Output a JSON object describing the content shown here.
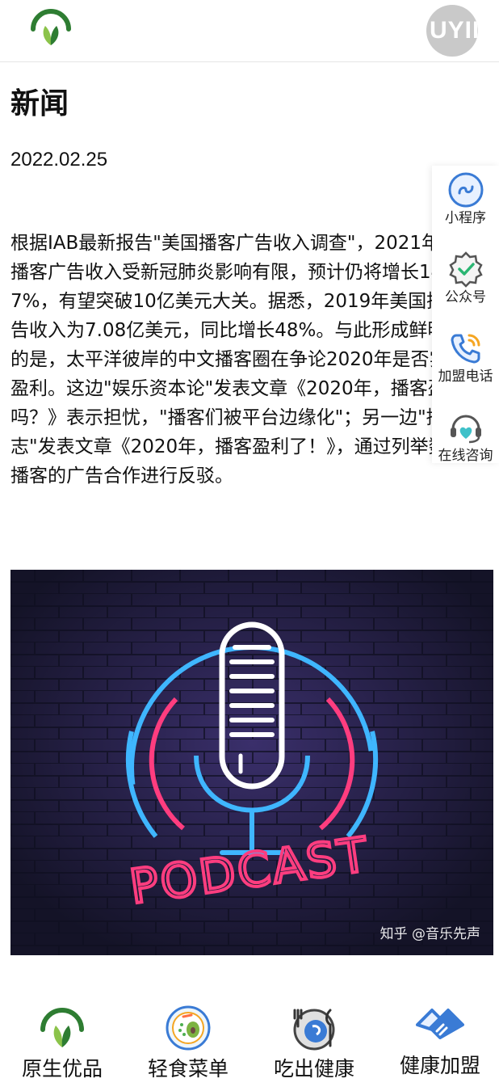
{
  "header": {
    "logo_icon": "leaf-logo-icon",
    "avatar_text": "UYII"
  },
  "page": {
    "title": "新闻",
    "date": "2022.02.25"
  },
  "article": {
    "paragraph": "根据IAB最新报告\"美国播客广告收入调查\"，2021年美国播客广告收入受新冠肺炎影响有限，预计仍将增长14.7%，有望突破10亿美元大关。据悉，2019年美国播客广告收入为7.08亿美元，同比增长48%。与此形成鲜明对比的是，太平洋彼岸的中文播客圈在争论2020年是否实现了盈利。这边\"娱乐资本论\"发表文章《2020年，播客盈利了吗？》表示担忧，\"播客们被平台边缘化\"；另一边\"播客志\"发表文章《2020年，播客盈利了！》，通过列举数十个播客的广告合作进行反驳。"
  },
  "side_panel": {
    "items": [
      {
        "label": "小程序",
        "icon": "mini-program-icon"
      },
      {
        "label": "公众号",
        "icon": "official-account-icon"
      },
      {
        "label": "加盟电话",
        "icon": "phone-icon"
      },
      {
        "label": "在线咨询",
        "icon": "chat-support-icon"
      }
    ]
  },
  "hero_image": {
    "sign_text": "PODCAST",
    "watermark": "知乎 @音乐先声"
  },
  "bottom_nav": {
    "items": [
      {
        "label": "原生优品",
        "icon": "leaf-icon"
      },
      {
        "label": "轻食菜单",
        "icon": "salad-bowl-icon"
      },
      {
        "label": "吃出健康",
        "icon": "plate-utensils-icon"
      },
      {
        "label": "健康加盟",
        "icon": "handshake-icon"
      }
    ]
  },
  "colors": {
    "brand_green": "#2e7d32",
    "accent_blue": "#3a7bd5",
    "neon_pink": "#ff3d7f",
    "neon_blue": "#3fb6ff"
  }
}
